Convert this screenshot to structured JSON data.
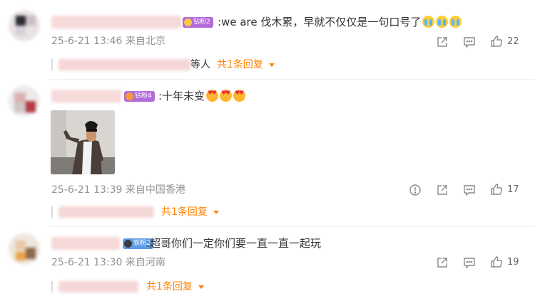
{
  "colors": {
    "accent": "#ff8200",
    "meta": "#939393",
    "badge_purple": "#b36bd9",
    "badge_blue": "#5c9ce6"
  },
  "comments": [
    {
      "badge": "钻粉2",
      "text": ":we are 伐木累，早就不仅仅是一句口号了",
      "emojis": [
        "cry-icon",
        "cry-icon",
        "cry-icon"
      ],
      "meta": "25-6-21 13:46 来自北京",
      "like_count": "22",
      "reply_tail": "等人",
      "reply_link": "共1条回复"
    },
    {
      "badge": "钻粉4",
      "text": ":十年未变",
      "emojis": [
        "love-face-icon",
        "love-face-icon",
        "love-face-icon"
      ],
      "has_image": true,
      "meta": "25-6-21 13:39 来自中国香港",
      "like_count": "17",
      "reply_link": "共1条回复"
    },
    {
      "badge": "铁粉2",
      "text": ":超哥你们一定你们要一直一直一起玩",
      "meta": "25-6-21 13:30 来自河南",
      "like_count": "19",
      "reply_link": "共1条回复"
    }
  ]
}
